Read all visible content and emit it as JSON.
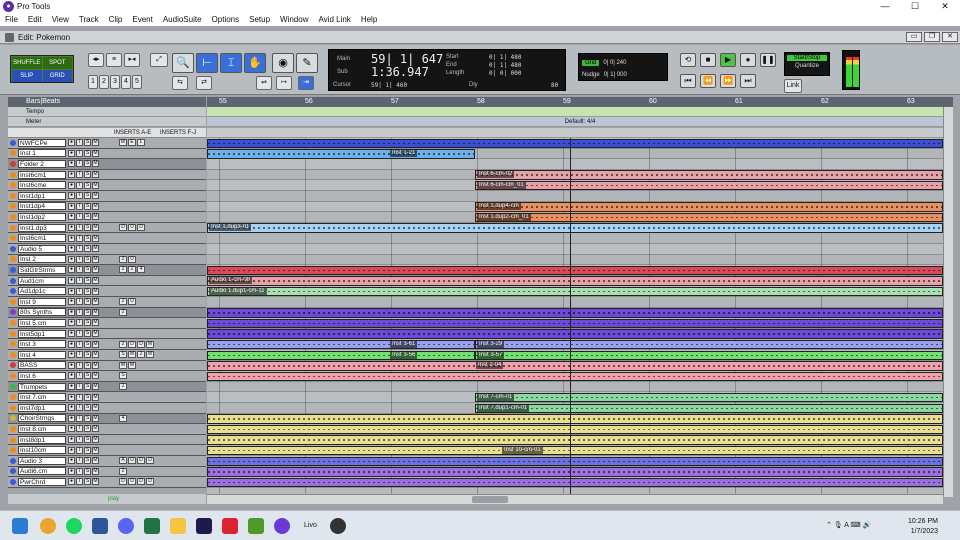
{
  "window": {
    "title": "Pro Tools",
    "controls": [
      "—",
      "☐",
      "✕"
    ]
  },
  "menu": [
    "File",
    "Edit",
    "View",
    "Track",
    "Clip",
    "Event",
    "AudioSuite",
    "Options",
    "Setup",
    "Window",
    "Avid Link",
    "Help"
  ],
  "edit_window": {
    "title": "Edit: Pokemon"
  },
  "modes": [
    "SHUFFLE",
    "SPOT",
    "SLIP",
    "GRID"
  ],
  "zoom_presets": [
    "1",
    "2",
    "3",
    "4",
    "5"
  ],
  "counter": {
    "main_label": "Main",
    "main_value": "59| 1| 647",
    "sub_label": "Sub",
    "sub_value": "1:36.947",
    "start_label": "Start",
    "start_value": "0| 1| 480",
    "end_label": "End",
    "end_value": "0| 1| 480",
    "length_label": "Length",
    "length_value": "0| 0| 000",
    "cursor_label": "Cursor",
    "cursor_value": "59| 1| 460",
    "dly_label": "Dly",
    "tempo_value": "80"
  },
  "grid": {
    "grid_label": "Grid",
    "grid_value": "0| 0| 240",
    "nudge_label": "Nudge",
    "nudge_value": "0| 1| 000"
  },
  "startstop": {
    "label": "Start/Stop",
    "quantize": "Quantize",
    "link": "Link"
  },
  "ruler": {
    "header": "Bars|Beats",
    "bars": [
      "55",
      "56",
      "57",
      "58",
      "59",
      "60",
      "61",
      "62",
      "63"
    ],
    "tempo": "Tempo",
    "meter": "Meter",
    "meter_value": "Default: 4/4"
  },
  "tracklist_header": {
    "inserts_ae": "INSERTS A-E",
    "inserts_fj": "INSERTS F-J"
  },
  "tracks": [
    {
      "name": "NWFCPe",
      "color": "#3b5bd6",
      "ins": [
        "M",
        "E",
        "L"
      ]
    },
    {
      "name": "Inst 1",
      "color": "#f08a1c",
      "ins": []
    },
    {
      "name": "Folder 2",
      "color": "#d03b3b",
      "ins": []
    },
    {
      "name": "Inst6cm1",
      "color": "#f08a1c",
      "ins": []
    },
    {
      "name": "Inst6cme",
      "color": "#f08a1c",
      "ins": []
    },
    {
      "name": "Inst1dp1",
      "color": "#f08a1c",
      "ins": []
    },
    {
      "name": "Inst1dp4",
      "color": "#f08a1c",
      "ins": []
    },
    {
      "name": "Inst1dp2",
      "color": "#f08a1c",
      "ins": []
    },
    {
      "name": "Inst1.dp3",
      "color": "#f08a1c",
      "ins": [
        "D",
        "D",
        "D"
      ]
    },
    {
      "name": "Inst6cm1",
      "color": "#f08a1c",
      "ins": []
    },
    {
      "name": "Audio 5",
      "color": "#3b5bd6",
      "ins": []
    },
    {
      "name": "Inst 2",
      "color": "#f08a1c",
      "ins": [
        "2",
        "D"
      ]
    },
    {
      "name": "SidGtrStrms",
      "color": "#3b5bd6",
      "ins": [
        "2",
        "2",
        "4"
      ]
    },
    {
      "name": "Aud1cm",
      "color": "#3b5bd6",
      "ins": []
    },
    {
      "name": "Ad1dp1c",
      "color": "#3b5bd6",
      "ins": []
    },
    {
      "name": "Inst 9",
      "color": "#f08a1c",
      "ins": [
        "2",
        "D"
      ]
    },
    {
      "name": "80s Synths",
      "color": "#7a3bd6",
      "ins": [
        "2"
      ]
    },
    {
      "name": "Inst 5.cm",
      "color": "#f08a1c",
      "ins": []
    },
    {
      "name": "Inst5dp1",
      "color": "#f08a1c",
      "ins": []
    },
    {
      "name": "Inst 3",
      "color": "#f08a1c",
      "ins": [
        "2",
        "D",
        "D",
        "M"
      ]
    },
    {
      "name": "Inst 4",
      "color": "#f08a1c",
      "ins": [
        "S",
        "M",
        "2",
        "M"
      ]
    },
    {
      "name": "BASS",
      "color": "#d03b3b",
      "ins": [
        "M",
        "M"
      ]
    },
    {
      "name": "Inst 6",
      "color": "#f08a1c",
      "ins": [
        "S"
      ]
    },
    {
      "name": "Trumpets",
      "color": "#3bb84a",
      "ins": [
        "2"
      ]
    },
    {
      "name": "Inst 7.cm",
      "color": "#f08a1c",
      "ins": []
    },
    {
      "name": "Inst7dp1",
      "color": "#f08a1c",
      "ins": []
    },
    {
      "name": "ChoirStrngs",
      "color": "#c9b83b",
      "ins": [
        "4"
      ]
    },
    {
      "name": "Inst 8.cm",
      "color": "#f08a1c",
      "ins": []
    },
    {
      "name": "Inst8dp1",
      "color": "#f08a1c",
      "ins": []
    },
    {
      "name": "Inst10cm",
      "color": "#f08a1c",
      "ins": []
    },
    {
      "name": "Audio 3",
      "color": "#3b5bd6",
      "ins": [
        "A",
        "D",
        "D",
        "D"
      ]
    },
    {
      "name": "Audi6.cm",
      "color": "#3b5bd6",
      "ins": [
        "2"
      ]
    },
    {
      "name": "PwrChrd",
      "color": "#3b5bd6",
      "ins": [
        "D",
        "D",
        "D",
        "D"
      ]
    }
  ],
  "clips": [
    {
      "label": "Inst 1-21",
      "color": "#6fb0e8"
    },
    {
      "label": "Inst 6-cm-02",
      "color": "#e8a0a8"
    },
    {
      "label": "Inst 6-cm-cm_01",
      "color": "#e8a0a8"
    },
    {
      "label": "Inst 1.dup4-cm",
      "color": "#e89060"
    },
    {
      "label": "Inst 1.dup2-cm_01",
      "color": "#e89060"
    },
    {
      "label": "Inst 1.dup3-01",
      "color": "#a8d0f0"
    },
    {
      "label": "Audio 1-cm-08",
      "color": "#e8a0a8"
    },
    {
      "label": "Audio 1.dup1-cm-11",
      "color": "#a8e0b0"
    },
    {
      "label": "Inst 3-61",
      "color": "#9aa0f0"
    },
    {
      "label": "Inst 3-29",
      "color": "#9aa0f0"
    },
    {
      "label": "Inst 3-56",
      "color": "#70e070"
    },
    {
      "label": "Inst 3-57",
      "color": "#70e070"
    },
    {
      "label": "Inst 2-04",
      "color": "#f0a0a8"
    },
    {
      "label": "Inst 7-cm-01",
      "color": "#8ad8a0"
    },
    {
      "label": "Inst 7.dup1-cm-01",
      "color": "#8ad8a0"
    },
    {
      "label": "Inst 10-cm-01",
      "color": "#e8e090"
    }
  ],
  "bottom": {
    "play": "play"
  },
  "taskbar": {
    "label": "Livo",
    "time": "10:26 PM",
    "date": "1/7/2023"
  }
}
